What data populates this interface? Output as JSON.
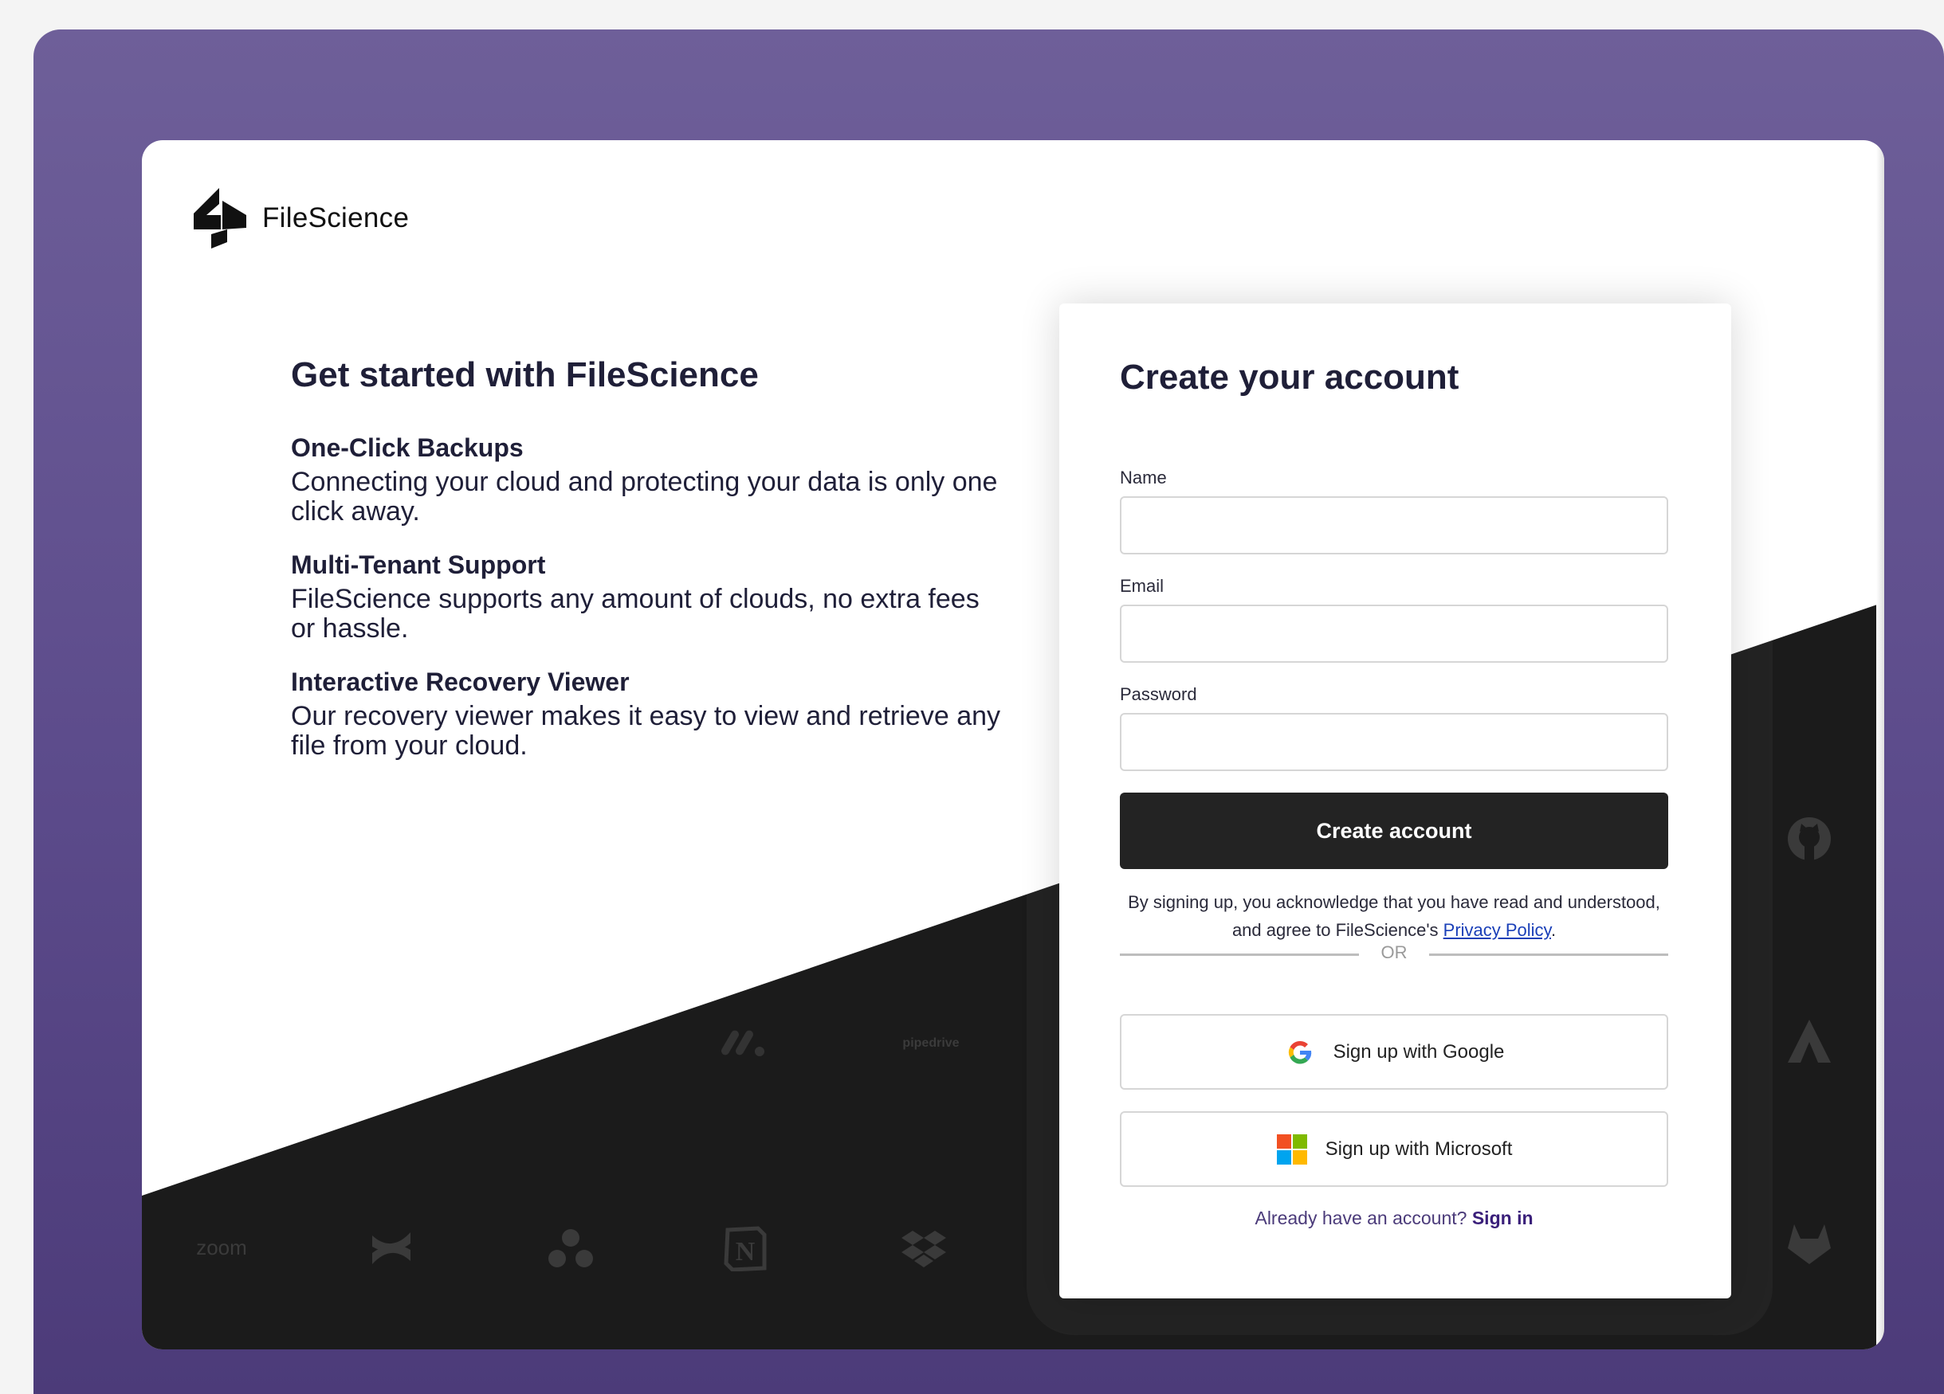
{
  "brand": {
    "name": "FileScience"
  },
  "intro": {
    "title": "Get started with FileScience",
    "features": [
      {
        "title": "One-Click Backups",
        "description": "Connecting your cloud and protecting your data is only one click away."
      },
      {
        "title": "Multi-Tenant Support",
        "description": "FileScience supports any amount of clouds, no extra fees or hassle."
      },
      {
        "title": "Interactive Recovery Viewer",
        "description": "Our recovery viewer makes it easy to view and retrieve any file from your cloud."
      }
    ]
  },
  "integrations": {
    "zoom_label": "zoom",
    "pipedrive_label": "pipedrive"
  },
  "form": {
    "title": "Create your account",
    "name_label": "Name",
    "email_label": "Email",
    "password_label": "Password",
    "name_value": "",
    "email_value": "",
    "password_value": "",
    "submit_label": "Create account",
    "legal_text": "By signing up, you acknowledge that you have read and understood, and agree to FileScience's",
    "privacy_link": "Privacy Policy",
    "legal_end": ".",
    "or_label": "OR",
    "google_label": "Sign up with Google",
    "microsoft_label": "Sign up with Microsoft",
    "signin_prompt": "Already have an account?",
    "signin_link": "Sign in"
  },
  "colors": {
    "frame": "#5c4b8b",
    "dark_panel": "#1b1b1b",
    "primary_button": "#232323",
    "link": "#1a3fb8"
  }
}
